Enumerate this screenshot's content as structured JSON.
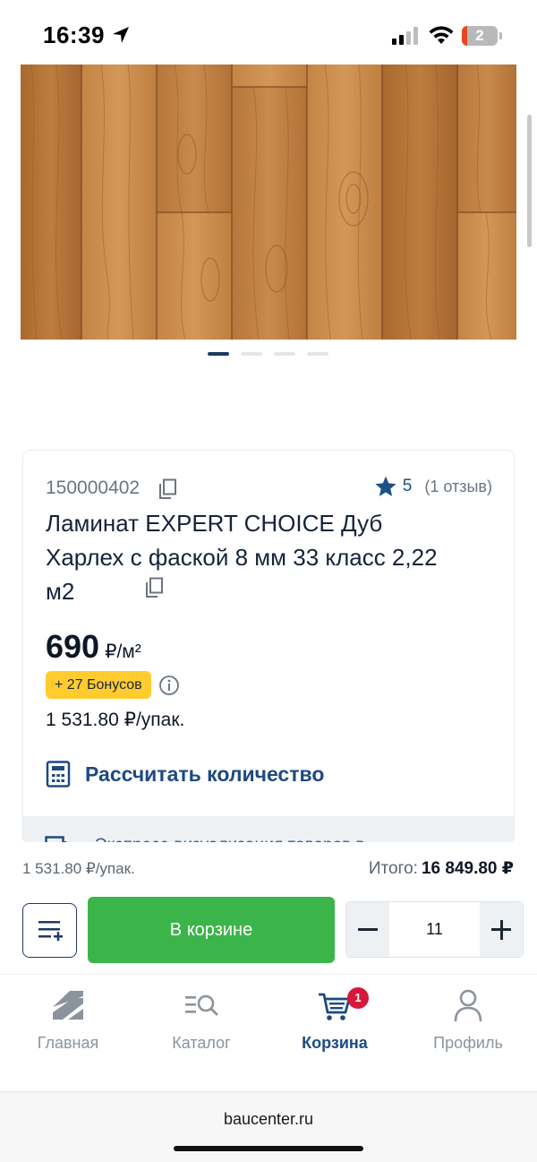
{
  "status_bar": {
    "time": "16:39",
    "battery_level": "2",
    "icons": [
      "location-arrow-icon",
      "signal-icon",
      "wifi-icon",
      "battery-icon"
    ]
  },
  "gallery": {
    "slide_count": 4,
    "active_slide": 1
  },
  "product": {
    "sku": "150000402",
    "rating": "5",
    "reviews": "(1 отзыв)",
    "title": "Ламинат EXPERT CHOICE Дуб Харлех с фаской 8 мм 33 класс 2,22 м2",
    "price": "690",
    "price_unit": "₽/м²",
    "bonus": "+ 27 Бонусов",
    "pack_price": "1 531.80 ₽/упак.",
    "calc_label": "Рассчитать количество",
    "hint_partial": "Экспресс-визуализация товаров в"
  },
  "purchase": {
    "pack_summary": "1 531.80 ₽/упак.",
    "total_label": "Итого:",
    "total_value": "16 849.80 ₽",
    "cart_button": "В корзине",
    "quantity": "11"
  },
  "tabs": [
    {
      "label": "Главная",
      "icon": "home-icon"
    },
    {
      "label": "Каталог",
      "icon": "catalog-search-icon"
    },
    {
      "label": "Корзина",
      "icon": "cart-icon",
      "badge": "1",
      "active": true
    },
    {
      "label": "Профиль",
      "icon": "profile-icon"
    }
  ],
  "browser": {
    "url": "baucenter.ru"
  },
  "colors": {
    "accent_blue": "#1d4a80",
    "cart_green": "#3bb54a",
    "bonus_yellow": "#ffcb2e",
    "badge_red": "#d6193b"
  }
}
